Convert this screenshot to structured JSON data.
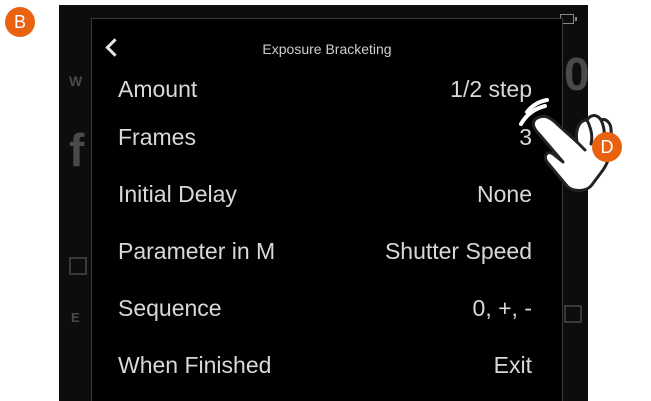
{
  "callouts": {
    "b": "B",
    "d": "D"
  },
  "menu": {
    "title": "Exposure Bracketing",
    "rows": [
      {
        "label": "Amount",
        "value": "1/2 step"
      },
      {
        "label": "Frames",
        "value": "3"
      },
      {
        "label": "Initial Delay",
        "value": "None"
      },
      {
        "label": "Parameter in M",
        "value": "Shutter Speed"
      },
      {
        "label": "Sequence",
        "value": "0, +, -"
      },
      {
        "label": "When Finished",
        "value": "Exit"
      }
    ]
  },
  "icons": {
    "back": "chevron-left-icon",
    "battery": "battery-icon",
    "hand": "tap-gesture-hand-icon"
  },
  "colors": {
    "callout": "#e8620f",
    "screen_bg": "#000000",
    "text": "#d8d8d8"
  }
}
